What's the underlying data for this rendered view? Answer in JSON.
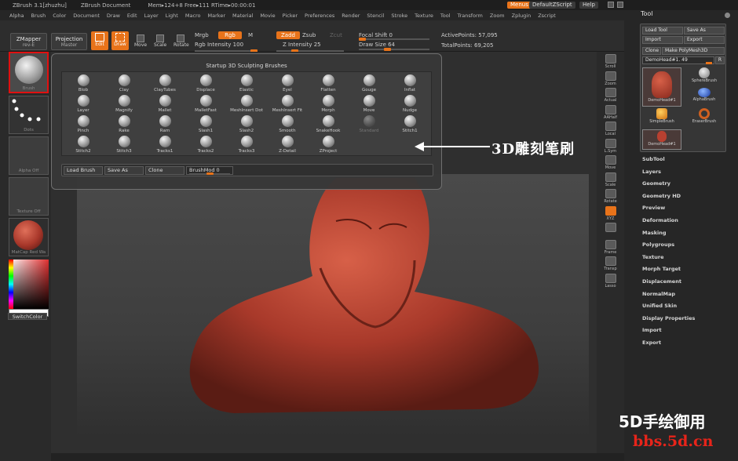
{
  "titlebar": {
    "app": "ZBrush 3.1[zhuzhu]",
    "doc": "ZBrush Document",
    "mem": "Mem▸124+8 Free▸111 RTime▸00:00:01",
    "menus_btn": "Menus",
    "script_btn": "DefaultZScript",
    "help_btn": "Help"
  },
  "menubar": [
    "Alpha",
    "Brush",
    "Color",
    "Document",
    "Draw",
    "Edit",
    "Layer",
    "Light",
    "Macro",
    "Marker",
    "Material",
    "Movie",
    "Picker",
    "Preferences",
    "Render",
    "Stencil",
    "Stroke",
    "Texture",
    "Tool",
    "Transform",
    "Zoom",
    "Zplugin",
    "Zscript"
  ],
  "toolbar": {
    "zmapper": "ZMapper",
    "zmapper_sub": "rev-E",
    "projection": "Projection",
    "projection_sub": "Master",
    "edit": "Edit",
    "draw": "Draw",
    "move": "Move",
    "scale": "Scale",
    "rotate": "Rotate",
    "mrgb": "Mrgb",
    "rgb": "Rgb",
    "m": "M",
    "rgb_intensity": "Rgb Intensity 100",
    "zadd": "Zadd",
    "zsub": "Zsub",
    "zcut": "Zcut",
    "z_intensity": "Z Intensity 25",
    "focal_shift": "Focal Shift 0",
    "draw_size": "Draw Size 64",
    "active_points": "ActivePoints: 57,095",
    "total_points": "TotalPoints: 69,205",
    "rgb_intensity_level": 1.0,
    "z_intensity_level": 0.25,
    "focal_shift_level": 0.0,
    "draw_size_level": 0.4
  },
  "leftshelf": {
    "brush": "Brush",
    "dots": "Dots",
    "alpha": "Alpha Off",
    "texture": "Texture Off",
    "material": "MatCap Red Wa",
    "switch_color": "SwitchColor"
  },
  "popup": {
    "title": "Startup 3D Sculpting Brushes",
    "brushes": [
      [
        "Blob",
        "Clay",
        "ClayTubes",
        "Displace",
        "Elastic",
        "Eyel",
        "Flatten",
        "Gouge",
        "Inflat"
      ],
      [
        "Layer",
        "Magnify",
        "Mallet",
        "MalletFast",
        "MeshInsert Dot",
        "MeshInsert Fit",
        "Morph",
        "Move",
        "Nudge"
      ],
      [
        "Pinch",
        "Rake",
        "Ram",
        "Slash1",
        "Slash2",
        "Smooth",
        "SnakeHook",
        "Standard",
        "Stitch1"
      ],
      [
        "Stitch2",
        "Stitch3",
        "Tracks1",
        "Tracks2",
        "Tracks3",
        "Z-Detail",
        "ZProject",
        "",
        ""
      ]
    ],
    "load_brush": "Load Brush",
    "save_as": "Save As",
    "clone": "Clone",
    "brushmod": "BrushMod 0",
    "brushmod_level": 0.5
  },
  "rightshelf": [
    "Scroll",
    "Zoom",
    "Actual",
    "AAHalf",
    "Local",
    "L.Sym",
    "Move",
    "Scale",
    "Rotate",
    "XYZ",
    "",
    "Frame",
    "Transp",
    "Lasso"
  ],
  "tray": {
    "title": "Tool",
    "load_tool": "Load Tool",
    "save_as": "Save As",
    "import": "Import",
    "export": "Export",
    "clone": "Clone",
    "make_polymesh": "Make PolyMesh3D",
    "current": "DemoHead#1. 49",
    "r": "R",
    "thumbs": [
      "DemoHead#1",
      "SphereBrush",
      "AlphaBrush",
      "SimpleBrush",
      "EraserBrush",
      "DemoHead#1"
    ],
    "items": [
      "SubTool",
      "Layers",
      "Geometry",
      "Geometry HD",
      "Preview",
      "Deformation",
      "Masking",
      "Polygroups",
      "Texture",
      "Morph Target",
      "Displacement",
      "NormalMap",
      "Unified Skin",
      "Display Properties",
      "Import",
      "Export"
    ]
  },
  "annotation": "3D雕刻笔刷",
  "watermark": {
    "line1": "5D手绘御用",
    "line2": "bbs.5d.cn"
  }
}
